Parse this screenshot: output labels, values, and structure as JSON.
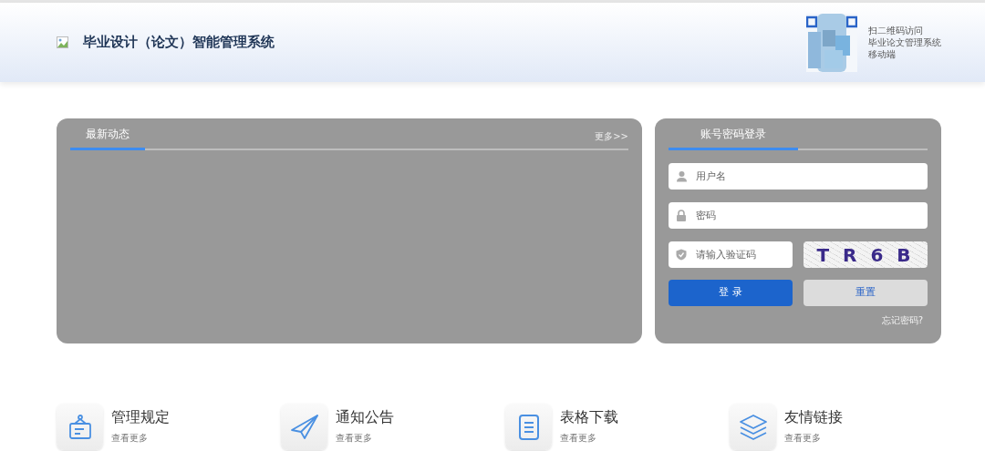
{
  "header": {
    "title": "毕业设计（论文）智能管理系统",
    "qr_caption": [
      "扫二维码访问",
      "毕业论文管理系统",
      "移动端"
    ]
  },
  "news": {
    "tabs": [
      {
        "label": "最新动态",
        "selected": true
      }
    ],
    "more": "更多>>"
  },
  "login": {
    "tabs": [
      {
        "label": "账号密码登录",
        "selected": true
      }
    ],
    "fields": [
      {
        "kind": "user",
        "placeholder": "用户名"
      },
      {
        "kind": "lock",
        "placeholder": "密码"
      },
      {
        "kind": "shield",
        "placeholder": "请输入验证码"
      }
    ],
    "captcha": "T R 6 B",
    "submit": "登 录",
    "reset": "重置",
    "forgot": "忘记密码?"
  },
  "shortcuts": [
    {
      "kind": "sign",
      "title": "管理规定",
      "link": "查看更多"
    },
    {
      "kind": "plane",
      "title": "通知公告",
      "link": "查看更多"
    },
    {
      "kind": "doc",
      "title": "表格下载",
      "link": "查看更多"
    },
    {
      "kind": "layers",
      "title": "友情链接",
      "link": "查看更多"
    }
  ]
}
